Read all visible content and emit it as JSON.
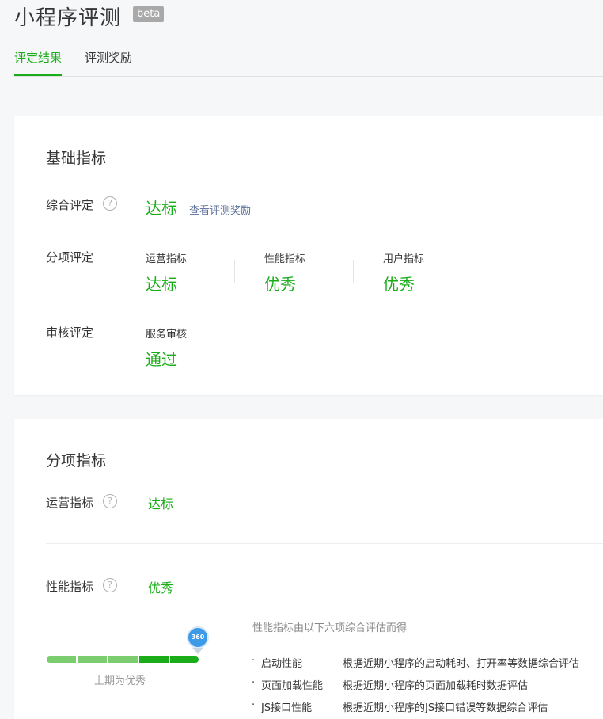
{
  "header": {
    "title": "小程序评测",
    "badge": "beta",
    "tabs": [
      {
        "label": "评定结果",
        "active": true
      },
      {
        "label": "评测奖励",
        "active": false
      }
    ]
  },
  "basic": {
    "title": "基础指标",
    "overall": {
      "label": "综合评定",
      "help": "?",
      "value": "达标",
      "link": "查看评测奖励"
    },
    "sub": {
      "label": "分项评定",
      "items": [
        {
          "name": "运营指标",
          "value": "达标"
        },
        {
          "name": "性能指标",
          "value": "优秀"
        },
        {
          "name": "用户指标",
          "value": "优秀"
        }
      ]
    },
    "review": {
      "label": "审核评定",
      "item_name": "服务审核",
      "item_value": "通过"
    }
  },
  "detail": {
    "title": "分项指标",
    "operation": {
      "label": "运营指标",
      "help": "?",
      "value": "达标"
    },
    "performance": {
      "label": "性能指标",
      "help": "?",
      "value": "优秀",
      "level_fraction": 1.0,
      "pin_text": "360",
      "last_period": "上期为优秀",
      "intro": "性能指标由以下六项综合评估而得",
      "items": [
        {
          "name": "启动性能",
          "desc": "根据近期小程序的启动耗时、打开率等数据综合评估"
        },
        {
          "name": "页面加载性能",
          "desc": "根据近期小程序的页面加载耗时数据评估"
        },
        {
          "name": "JS接口性能",
          "desc": "根据近期小程序的JS接口错误等数据综合评估"
        }
      ]
    }
  },
  "colors": {
    "accent": "#1aad19",
    "link": "#576b95",
    "background": "#f6f7f9"
  }
}
